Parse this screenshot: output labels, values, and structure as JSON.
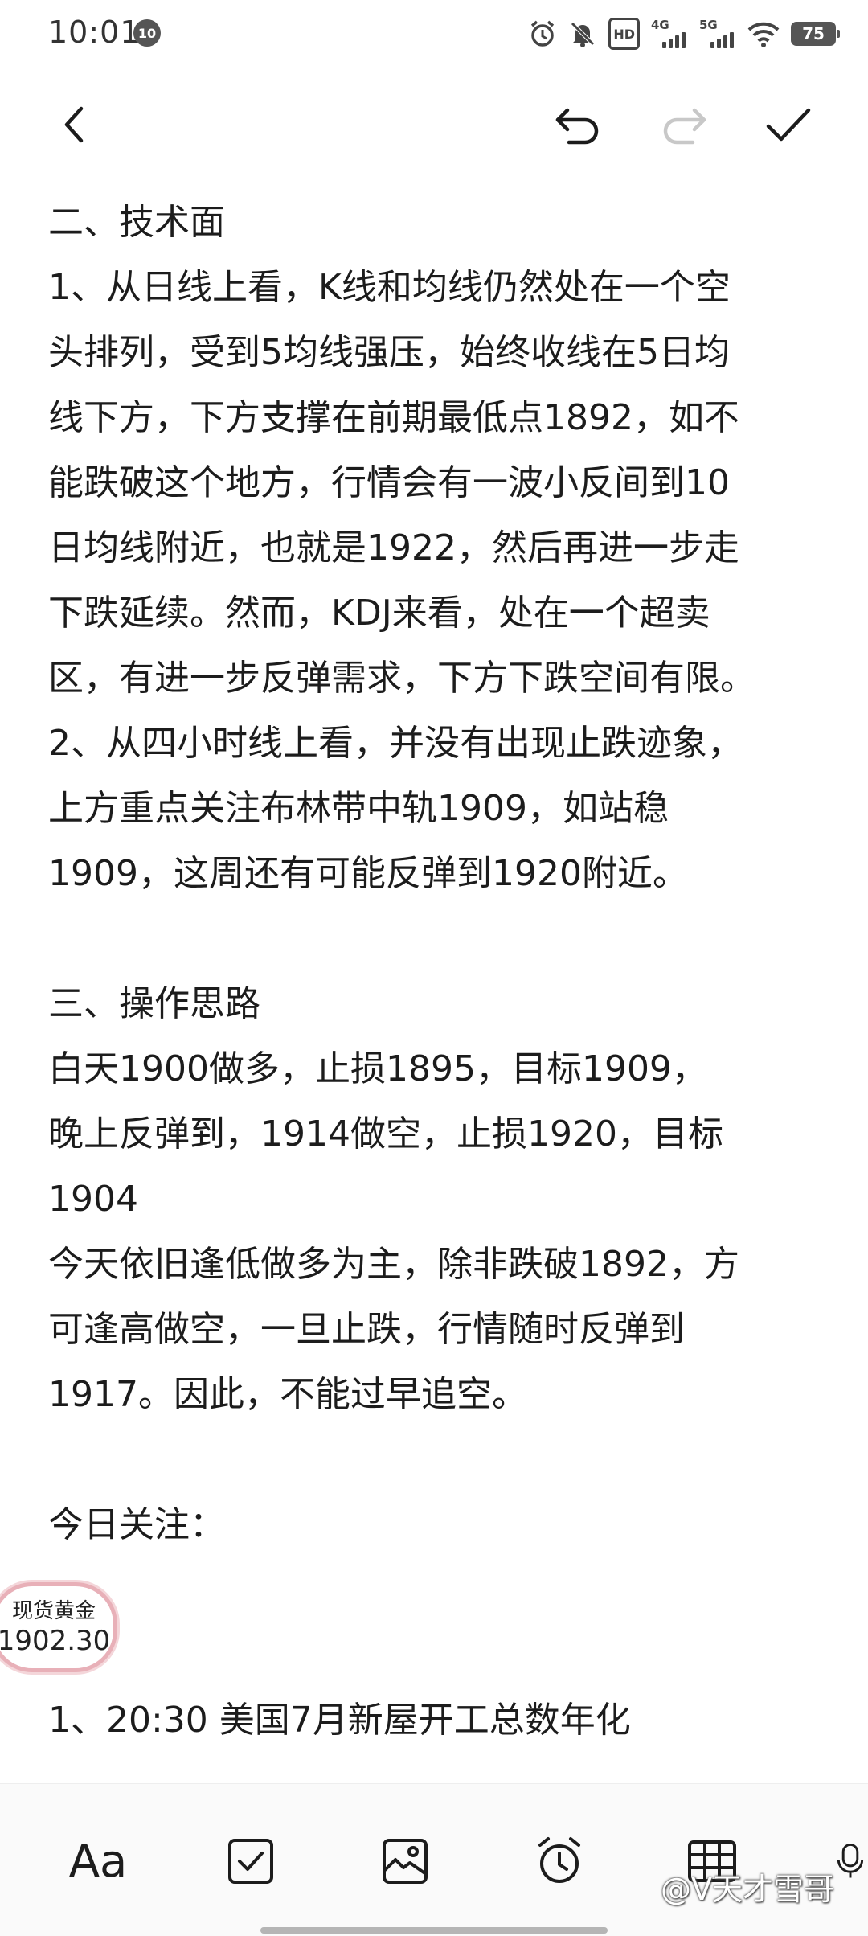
{
  "status_bar": {
    "time": "10:01",
    "notification_badge": "10",
    "hd_label": "HD",
    "signal1_label": "4G",
    "signal2_label": "5G",
    "battery": "75"
  },
  "note": {
    "paragraphs": [
      "二、技术面",
      "1、从日线上看，K线和均线仍然处在一个空",
      "头排列，受到5均线强压，始终收线在5日均",
      "线下方，下方支撑在前期最低点1892，如不",
      "能跌破这个地方，行情会有一波小反间到10",
      "日均线附近，也就是1922，然后再进一步走",
      "下跌延续。然而，KDJ来看，处在一个超卖",
      "区，有进一步反弹需求，下方下跌空间有限。",
      "2、从四小时线上看，并没有出现止跌迹象，",
      "上方重点关注布林带中轨1909，如站稳",
      "1909，这周还有可能反弹到1920附近。",
      "",
      "三、操作思路",
      "白天1900做多，止损1895，目标1909，",
      "晚上反弹到，1914做空，止损1920，目标",
      "1904",
      "今天依旧逢低做多为主，除非跌破1892，方",
      "可逢高做空，一旦止跌，行情随时反弹到",
      "1917。因此，不能过早追空。",
      "",
      "今日关注：",
      "",
      "",
      "1、20:30 美国7月新屋开工总数年化"
    ],
    "price_card": {
      "name": "现货黄金",
      "value": "1902.30"
    }
  },
  "bottom_bar": {
    "text_format_label": "Aa",
    "watermark": "@V天才雪哥"
  },
  "colors": {
    "background": "#ffffff",
    "text": "#1c1c1c",
    "icon": "#1c1c1c",
    "icon_disabled": "#c8c8c8",
    "price_border": "#e8b0b8"
  }
}
